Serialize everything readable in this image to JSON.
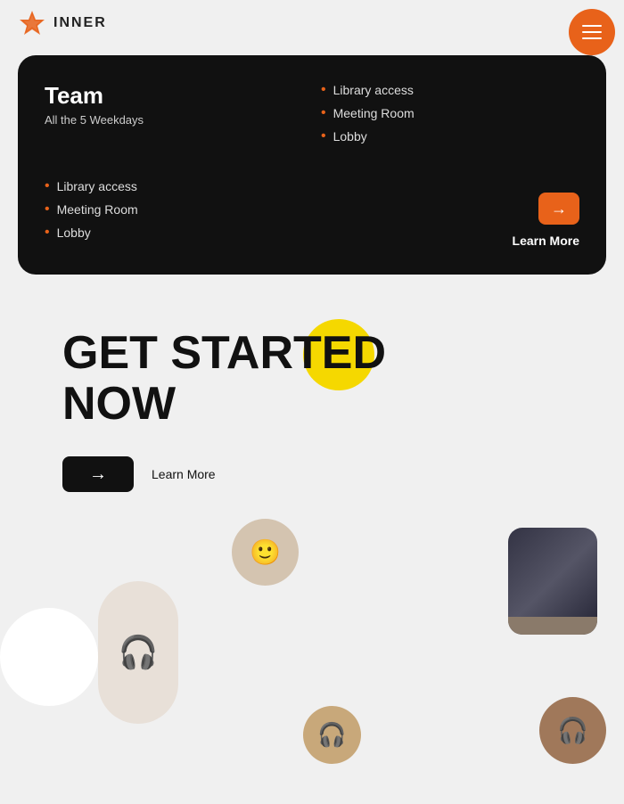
{
  "logo": {
    "text": "INNER"
  },
  "hamburger": {
    "label": "Menu"
  },
  "card": {
    "title": "Team",
    "subtitle": "All the 5 Weekdays",
    "features_right": [
      "Library access",
      "Meeting Room",
      "Lobby"
    ],
    "features_left": [
      "Library access",
      "Meeting Room",
      "Lobby"
    ],
    "arrow_label": "→",
    "learn_more": "Learn More"
  },
  "get_started": {
    "line1": "GET STARTED",
    "line2": "NOW",
    "arrow_label": "→",
    "learn_more": "Learn More"
  },
  "images": {
    "face_emoji": "🙂",
    "headphones_emoji": "🎧",
    "headphones2_emoji": "🎧",
    "headset_emoji": "🎧"
  }
}
